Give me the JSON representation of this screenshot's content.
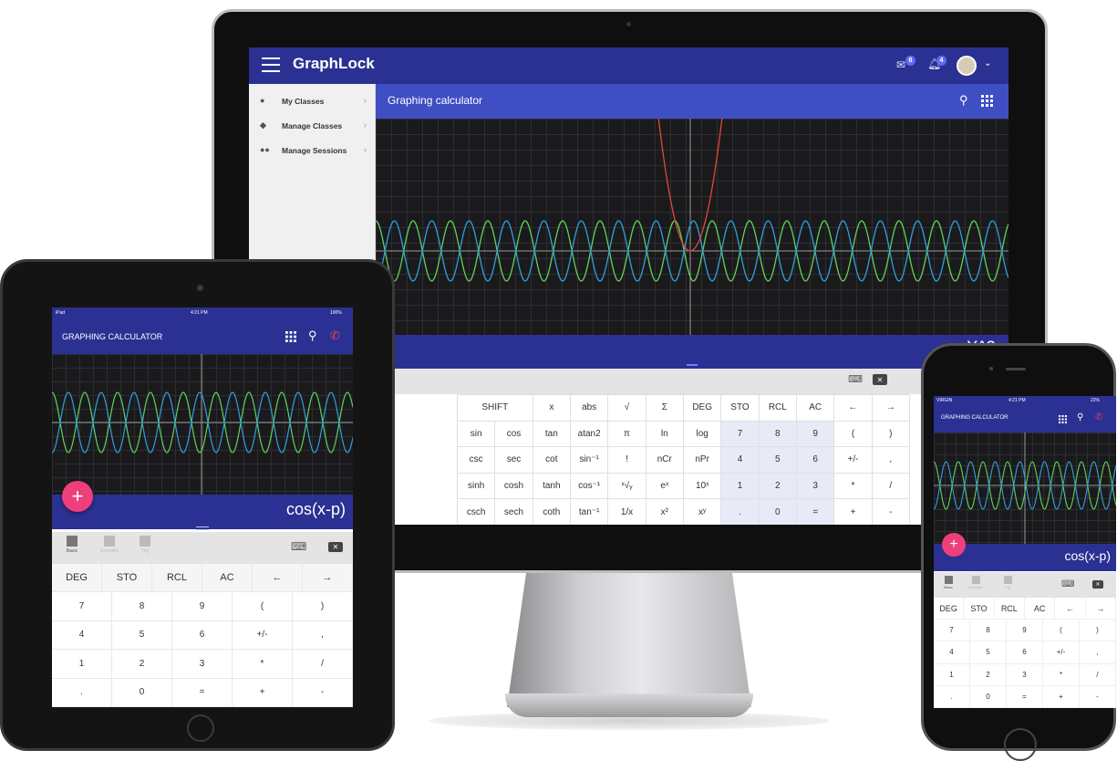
{
  "desktop": {
    "brand": "GraphLock",
    "mail_badge": "8",
    "bell_badge": "4",
    "sidebar": [
      {
        "label": "My Classes",
        "icon": "person-icon"
      },
      {
        "label": "Manage Classes",
        "icon": "graduation-cap-icon"
      },
      {
        "label": "Manage Sessions",
        "icon": "group-icon"
      }
    ],
    "title": "Graphing calculator",
    "expression": "X^2",
    "keypad": [
      [
        "SHIFT",
        "x",
        "abs",
        "√",
        "Σ",
        "DEG",
        "STO",
        "RCL",
        "AC",
        "←",
        "→"
      ],
      [
        "sin",
        "cos",
        "tan",
        "atan2",
        "π",
        "ln",
        "log",
        "7",
        "8",
        "9",
        "(",
        ")"
      ],
      [
        "csc",
        "sec",
        "cot",
        "sin⁻¹",
        "!",
        "nCr",
        "nPr",
        "4",
        "5",
        "6",
        "+/-",
        ","
      ],
      [
        "sinh",
        "cosh",
        "tanh",
        "cos⁻¹",
        "ˣ√ᵧ",
        "eˣ",
        "10ˣ",
        "1",
        "2",
        "3",
        "*",
        "/"
      ],
      [
        "csch",
        "sech",
        "coth",
        "tan⁻¹",
        "1/x",
        "x²",
        "xʸ",
        ".",
        "0",
        "=",
        "+",
        "-"
      ]
    ]
  },
  "tablet": {
    "status_left": "iPad",
    "status_time": "4:21 PM",
    "status_right": "100%",
    "title": "GRAPHING CALCULATOR",
    "expression": "cos(x-p)",
    "tabs": [
      {
        "label": "Basic",
        "icon": "calculator-icon"
      },
      {
        "label": "Scientific",
        "icon": "scientific-icon"
      },
      {
        "label": "Trig",
        "icon": "trig-icon"
      }
    ],
    "keypad": [
      [
        "DEG",
        "STO",
        "RCL",
        "AC",
        "←",
        "→"
      ],
      [
        "7",
        "8",
        "9",
        "(",
        ")"
      ],
      [
        "4",
        "5",
        "6",
        "+/-",
        ","
      ],
      [
        "1",
        "2",
        "3",
        "*",
        "/"
      ],
      [
        ".",
        "0",
        "=",
        "+",
        "-"
      ]
    ]
  },
  "phone": {
    "status_left": "VIRGIN",
    "status_time": "4:21 PM",
    "status_right": "22%",
    "title": "GRAPHING CALCULATOR",
    "expression": "cos(x-p)",
    "tabs": [
      {
        "label": "Basic",
        "icon": "calculator-icon"
      },
      {
        "label": "Scientific",
        "icon": "scientific-icon"
      },
      {
        "label": "Trig",
        "icon": "trig-icon"
      }
    ],
    "keypad": [
      [
        "DEG",
        "STO",
        "RCL",
        "AC",
        "←",
        "→"
      ],
      [
        "7",
        "8",
        "9",
        "(",
        ")"
      ],
      [
        "4",
        "5",
        "6",
        "+/-",
        ","
      ],
      [
        "1",
        "2",
        "3",
        "*",
        "/"
      ],
      [
        ".",
        "0",
        "=",
        "+",
        "-"
      ]
    ]
  },
  "colors": {
    "appbar": "#2b3192",
    "titlebar": "#3f4fc3",
    "fab": "#ef3f7a",
    "curve_green": "#5fd35a",
    "curve_blue": "#2f9fe0",
    "curve_red": "#e4463a"
  }
}
